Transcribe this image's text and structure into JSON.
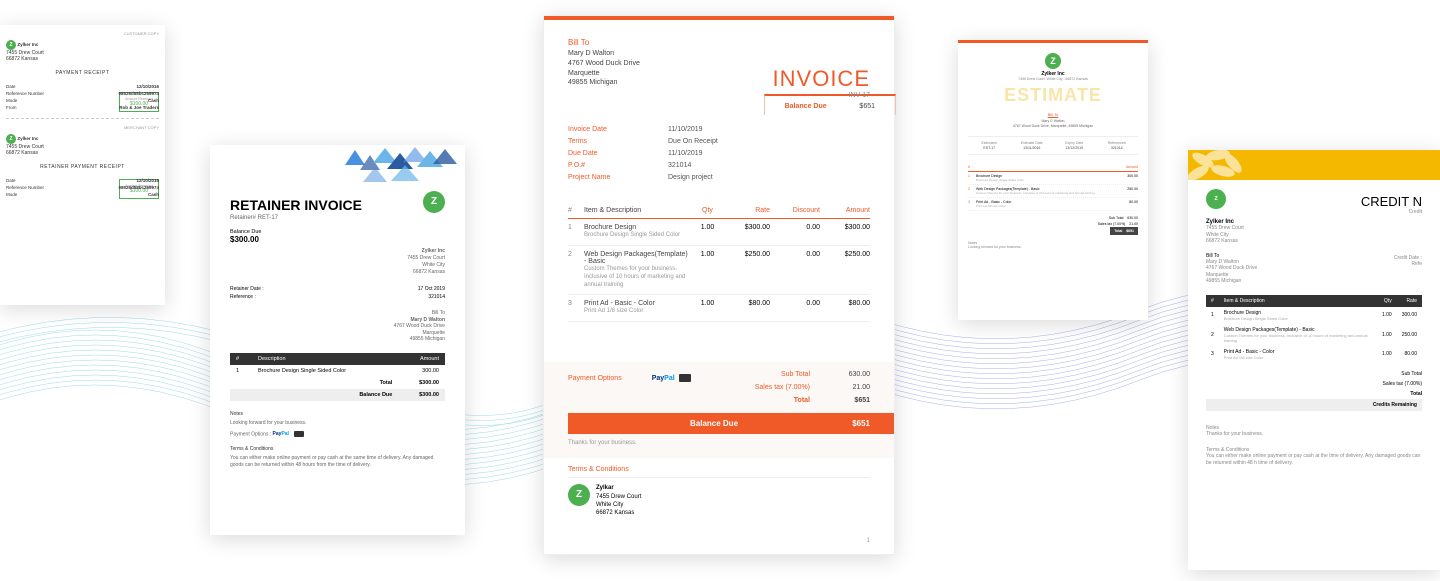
{
  "receipt": {
    "customer_copy": "CUSTOMER COPY",
    "merchant_copy": "MERCHANT COPY",
    "company": "Zylker Inc",
    "addr1": "7455 Drew Court",
    "addr2": "66872 Kansas",
    "title": "PAYMENT RECEIPT",
    "retainer_title": "RETAINER PAYMENT RECEIPT",
    "date_label": "Date",
    "date": "12/10/2016",
    "ref_label": "Reference Number",
    "ref": "08526d58bc269974",
    "mode_label": "Mode",
    "mode": "Cash",
    "from_label": "From",
    "from": "Rob & Joe Traders",
    "amount_label": "Amount Received",
    "amount": "$100.00"
  },
  "retainer": {
    "title": "RETAINER INVOICE",
    "number": "Retainer# RET-17",
    "balance_label": "Balance Due",
    "balance": "$300.00",
    "company": "Zylker Inc",
    "addr1": "7455 Drew Court",
    "addr2": "White City",
    "addr3": "66872 Kansas",
    "billto_label": "Bill To",
    "billto_name": "Mary D Walton",
    "billto_addr1": "4767 Wood Duck Drive",
    "billto_addr2": "Marquette",
    "billto_addr3": "49855 Michigan",
    "date_label": "Retainer Date :",
    "date": "17 Oct 2019",
    "ref_label": "Reference :",
    "ref": "321014",
    "th_n": "#",
    "th_desc": "Description",
    "th_amt": "Amount",
    "item_desc": "Brochure Design Single Sided Color",
    "item_amt": "300.00",
    "total_label": "Total",
    "total": "$300.00",
    "bal_label": "Balance Due",
    "bal": "$300.00",
    "notes_h": "Notes",
    "notes": "Looking forward for your business.",
    "payopt_label": "Payment Options :",
    "tc_h": "Terms & Conditions",
    "tc": "You can either make online payment or pay cash at the same time of delivery. Any damaged goods can be returned within 48 hours from the time of delivery."
  },
  "invoice": {
    "billto_label": "Bill To",
    "billto_name": "Mary D Walton",
    "billto_addr1": "4767 Wood Duck Drive",
    "billto_addr2": "Marquette",
    "billto_addr3": "49855 Michigan",
    "title": "INVOICE",
    "number": "INV-17",
    "balance_label": "Balance Due",
    "balance": "$651",
    "meta": [
      {
        "k": "Invoice Date",
        "v": "11/10/2019"
      },
      {
        "k": "Terms",
        "v": "Due On Receipt"
      },
      {
        "k": "Due Date",
        "v": "11/10/2019"
      },
      {
        "k": "P.O.#",
        "v": "321014"
      },
      {
        "k": "Project Name",
        "v": "Design project"
      }
    ],
    "th_n": "#",
    "th_desc": "Item & Description",
    "th_qty": "Qty",
    "th_rate": "Rate",
    "th_disc": "Discount",
    "th_amt": "Amount",
    "items": [
      {
        "n": "1",
        "name": "Brochure Design",
        "desc": "Brochure Design Single Sided Color",
        "qty": "1.00",
        "rate": "$300.00",
        "disc": "0.00",
        "amt": "$300.00"
      },
      {
        "n": "2",
        "name": "Web Design Packages(Template) - Basic",
        "desc": "Custom Themes for your business. Inclusive of 10 hours of marketing and annual training",
        "qty": "1.00",
        "rate": "$250.00",
        "disc": "0.00",
        "amt": "$250.00"
      },
      {
        "n": "3",
        "name": "Print Ad - Basic - Color",
        "desc": "Print Ad 1/8 size Color",
        "qty": "1.00",
        "rate": "$80.00",
        "disc": "0.00",
        "amt": "$80.00"
      }
    ],
    "payopt_label": "Payment Options",
    "subtotal_label": "Sub Total",
    "subtotal": "630.00",
    "tax_label": "Sales tax (7.00%)",
    "tax": "21.00",
    "total_label": "Total",
    "total": "$651",
    "baldue_label": "Balance Due",
    "baldue": "$651",
    "thanks": "Thanks for your business.",
    "tc_label": "Terms & Conditions",
    "company": "Zylkar",
    "co_addr1": "7455 Drew Court",
    "co_addr2": "White City",
    "co_addr3": "66872 Kansas",
    "page": "1"
  },
  "estimate": {
    "company": "Zylker Inc",
    "coaddr": "7455 Drew Court, White City , 66872 Kansas",
    "title": "ESTIMATE",
    "billto_label": "Bill To",
    "billto_name": "Mary D Walton",
    "billto_addr": "4767 Wood Duck Drive, Marquette, 49855 Michigan",
    "meta": [
      {
        "k": "Estimate#",
        "v": "EST-17"
      },
      {
        "k": "Estimate Date",
        "v": "13/11/2019"
      },
      {
        "k": "Expiry Date",
        "v": "13/12/2019"
      },
      {
        "k": "Reference#",
        "v": "321014"
      }
    ],
    "th_n": "#",
    "th_amt": "Amount",
    "items": [
      {
        "n": "1",
        "name": "Brochure Design",
        "desc": "Brochure Design Single Sided Color",
        "amt": "300.00"
      },
      {
        "n": "2",
        "name": "Web Design Packages(Template) - Basic",
        "desc": "Custom Themes for your business. Inclusive of 10 hours of marketing and annual training",
        "amt": "250.00"
      },
      {
        "n": "3",
        "name": "Print Ad - Basic - Color",
        "desc": "Print Ad 1/8 size Color",
        "amt": "80.00"
      }
    ],
    "subtotal_label": "Sub Total",
    "subtotal": "630.00",
    "tax_label": "Sales tax (7.00%)",
    "tax": "21.00",
    "total_label": "Total",
    "total": "$651",
    "notes_h": "Notes",
    "notes": "Looking forward for your business."
  },
  "credit": {
    "title": "CREDIT N",
    "sub": "Credit",
    "company": "Zylker Inc",
    "co_addr1": "7455 Drew Court",
    "co_addr2": "White City",
    "co_addr3": "66872 Kansas",
    "billto_label": "Bill To",
    "billto_name": "Mary D Walton",
    "billto_addr1": "4767 Wood Duck Drive",
    "billto_addr2": "Marquette",
    "billto_addr3": "49855 Michigan",
    "date_label": "Credit Date :",
    "ref_label": "Refe",
    "th_n": "#",
    "th_desc": "Item & Description",
    "th_qty": "Qty",
    "th_rate": "Rate",
    "items": [
      {
        "n": "1",
        "name": "Brochure Design",
        "desc": "Brochure Design Single Sided Color",
        "qty": "1.00",
        "rate": "300.00"
      },
      {
        "n": "2",
        "name": "Web Design Packages(Template) - Basic",
        "desc": "Custom Themes for your business. Inclusive of 10 hours of marketing and annual training",
        "qty": "1.00",
        "rate": "250.00"
      },
      {
        "n": "3",
        "name": "Print Ad - Basic - Color",
        "desc": "Print Ad 1/8 size Color",
        "qty": "1.00",
        "rate": "80.00"
      }
    ],
    "subtotal_label": "Sub Total",
    "tax_label": "Sales tax (7.00%)",
    "total_label": "Total",
    "rem_label": "Credits Remaining",
    "notes_h": "Notes",
    "notes": "Thanks for your business.",
    "tc_h": "Terms & Conditions",
    "tc": "You can either make online payment or pay cash at the time of delivery. Any damaged goods can be returned within 48 h time of delivery."
  },
  "brand": {
    "logo": "Z",
    "paypal1": "Pay",
    "paypal2": "Pal"
  }
}
